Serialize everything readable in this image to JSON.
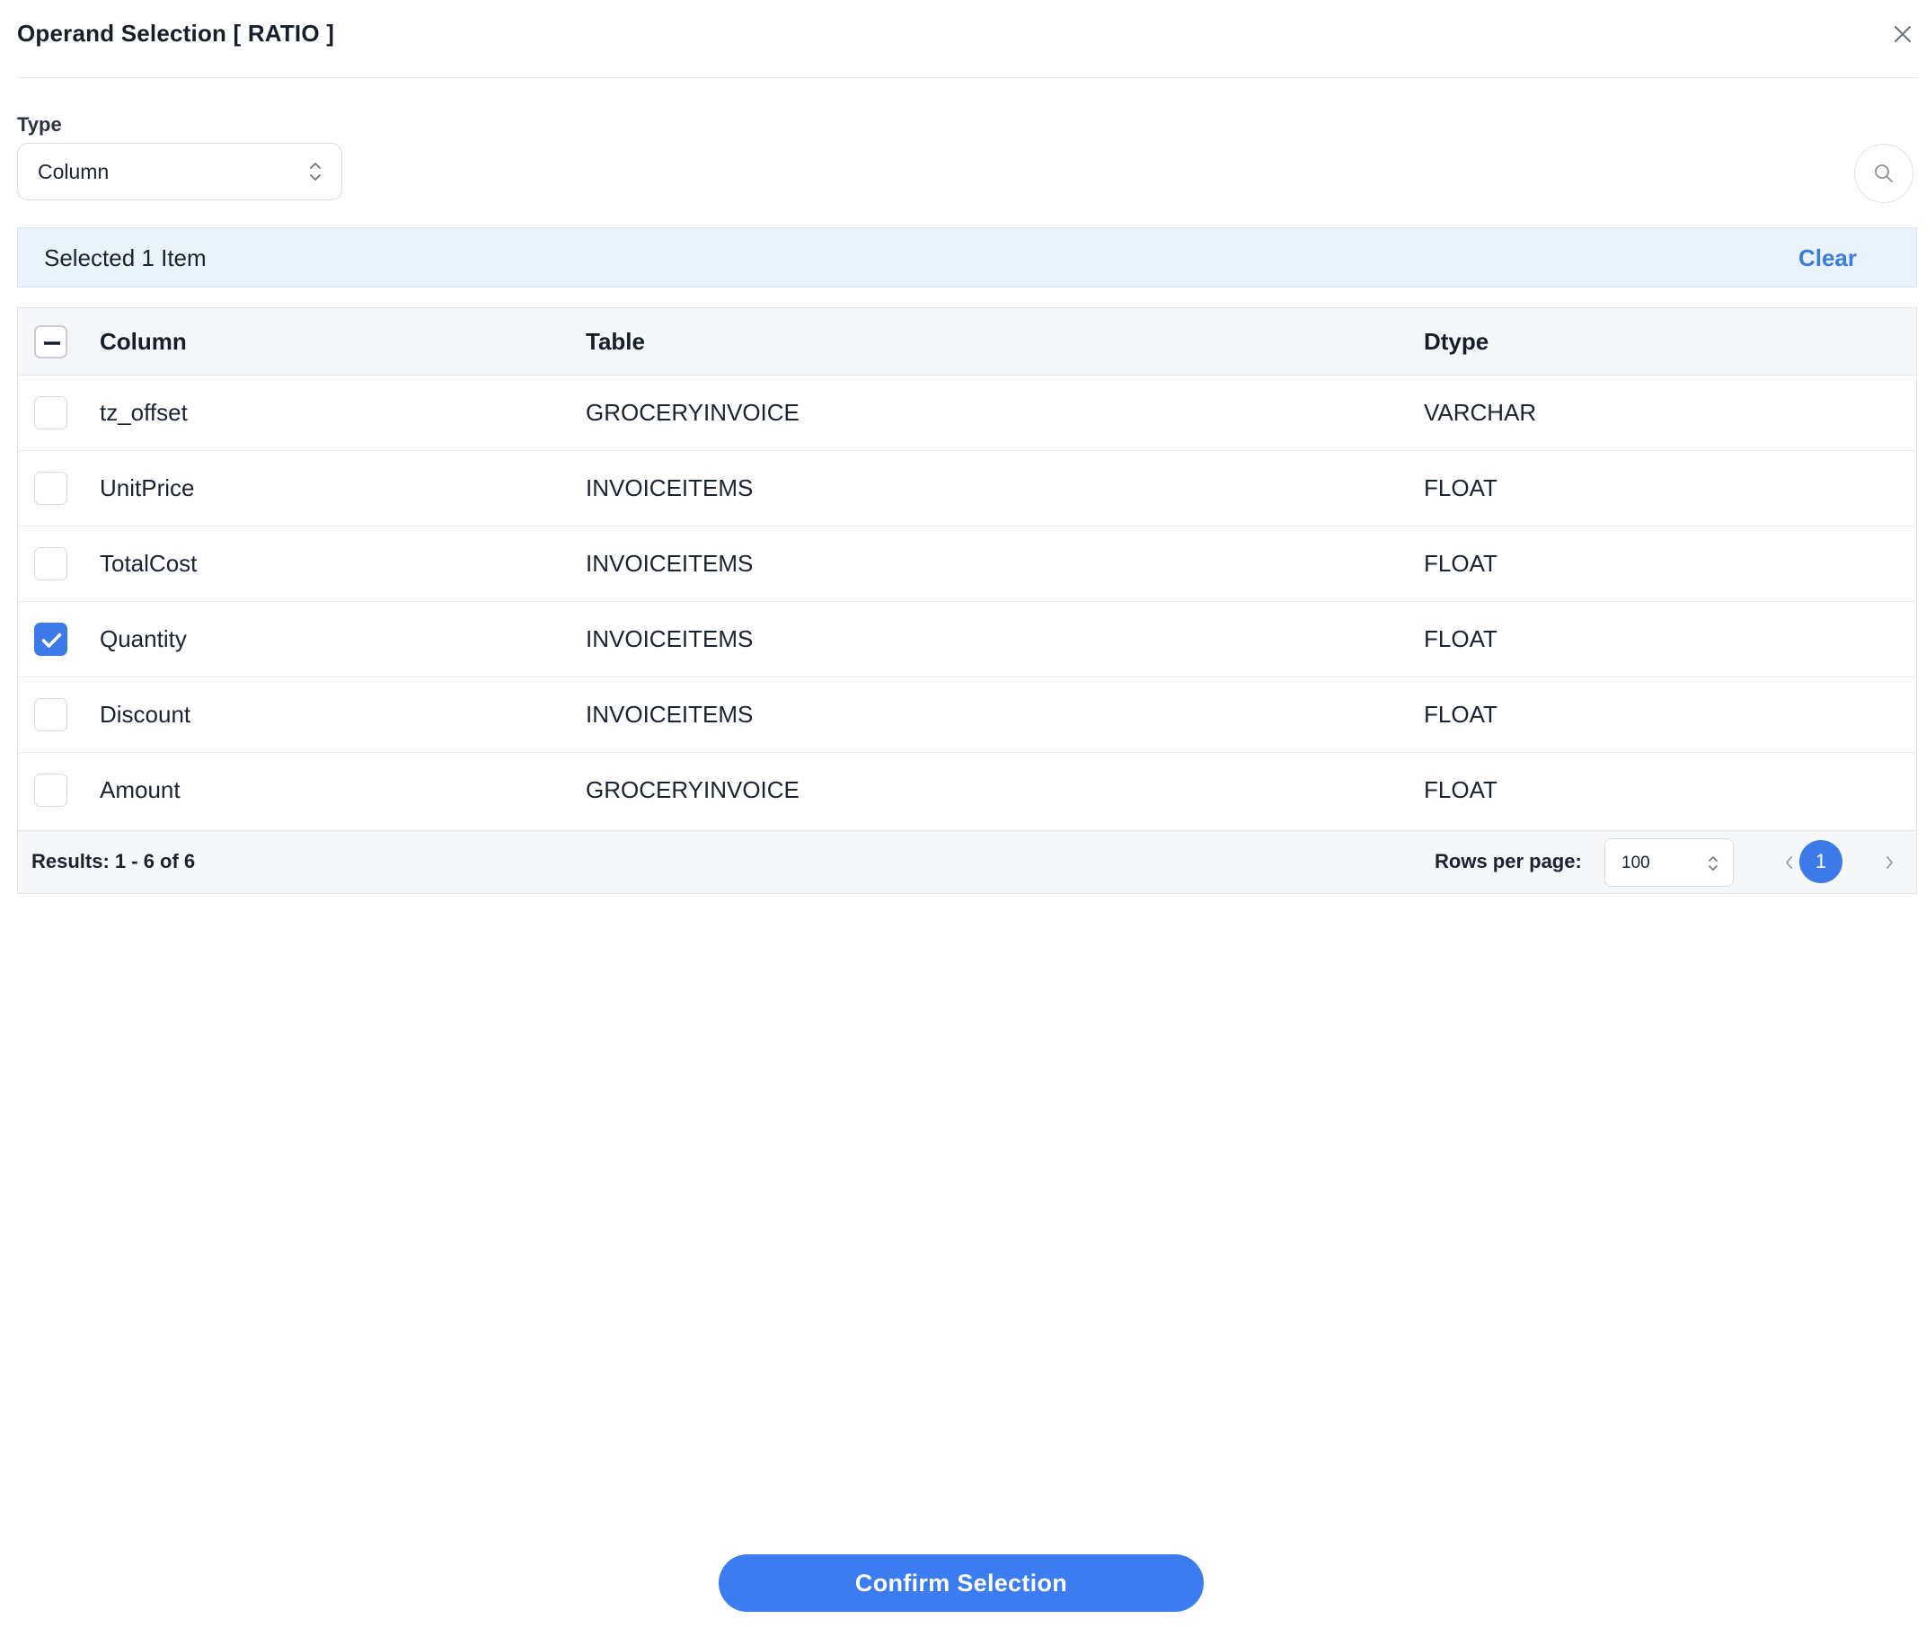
{
  "modal": {
    "title": "Operand Selection [ RATIO ]"
  },
  "type_filter": {
    "label": "Type",
    "value": "Column"
  },
  "selection": {
    "summary": "Selected 1 Item",
    "clear_label": "Clear"
  },
  "table": {
    "headers": {
      "column": "Column",
      "table": "Table",
      "dtype": "Dtype"
    },
    "rows": [
      {
        "column": "tz_offset",
        "table": "GROCERYINVOICE",
        "dtype": "VARCHAR",
        "checked": false
      },
      {
        "column": "UnitPrice",
        "table": "INVOICEITEMS",
        "dtype": "FLOAT",
        "checked": false
      },
      {
        "column": "TotalCost",
        "table": "INVOICEITEMS",
        "dtype": "FLOAT",
        "checked": false
      },
      {
        "column": "Quantity",
        "table": "INVOICEITEMS",
        "dtype": "FLOAT",
        "checked": true
      },
      {
        "column": "Discount",
        "table": "INVOICEITEMS",
        "dtype": "FLOAT",
        "checked": false
      },
      {
        "column": "Amount",
        "table": "GROCERYINVOICE",
        "dtype": "FLOAT",
        "checked": false
      }
    ]
  },
  "footer": {
    "results": "Results: 1 - 6 of 6",
    "rows_per_page_label": "Rows per page:",
    "rows_per_page_value": "100",
    "current_page": "1"
  },
  "actions": {
    "confirm_label": "Confirm Selection"
  },
  "icons": {
    "close": "close-icon",
    "search": "search-icon",
    "select": "chevron-updown-icon",
    "prev": "chevron-left-icon",
    "next": "chevron-right-icon",
    "check": "check-icon",
    "indeterminate": "minus-icon"
  },
  "colors": {
    "accent": "#3b7ae8",
    "selection_bar": "#eaf3fc",
    "clear_link": "#3b7ce0",
    "table_header_bg": "#f6f7f9"
  }
}
